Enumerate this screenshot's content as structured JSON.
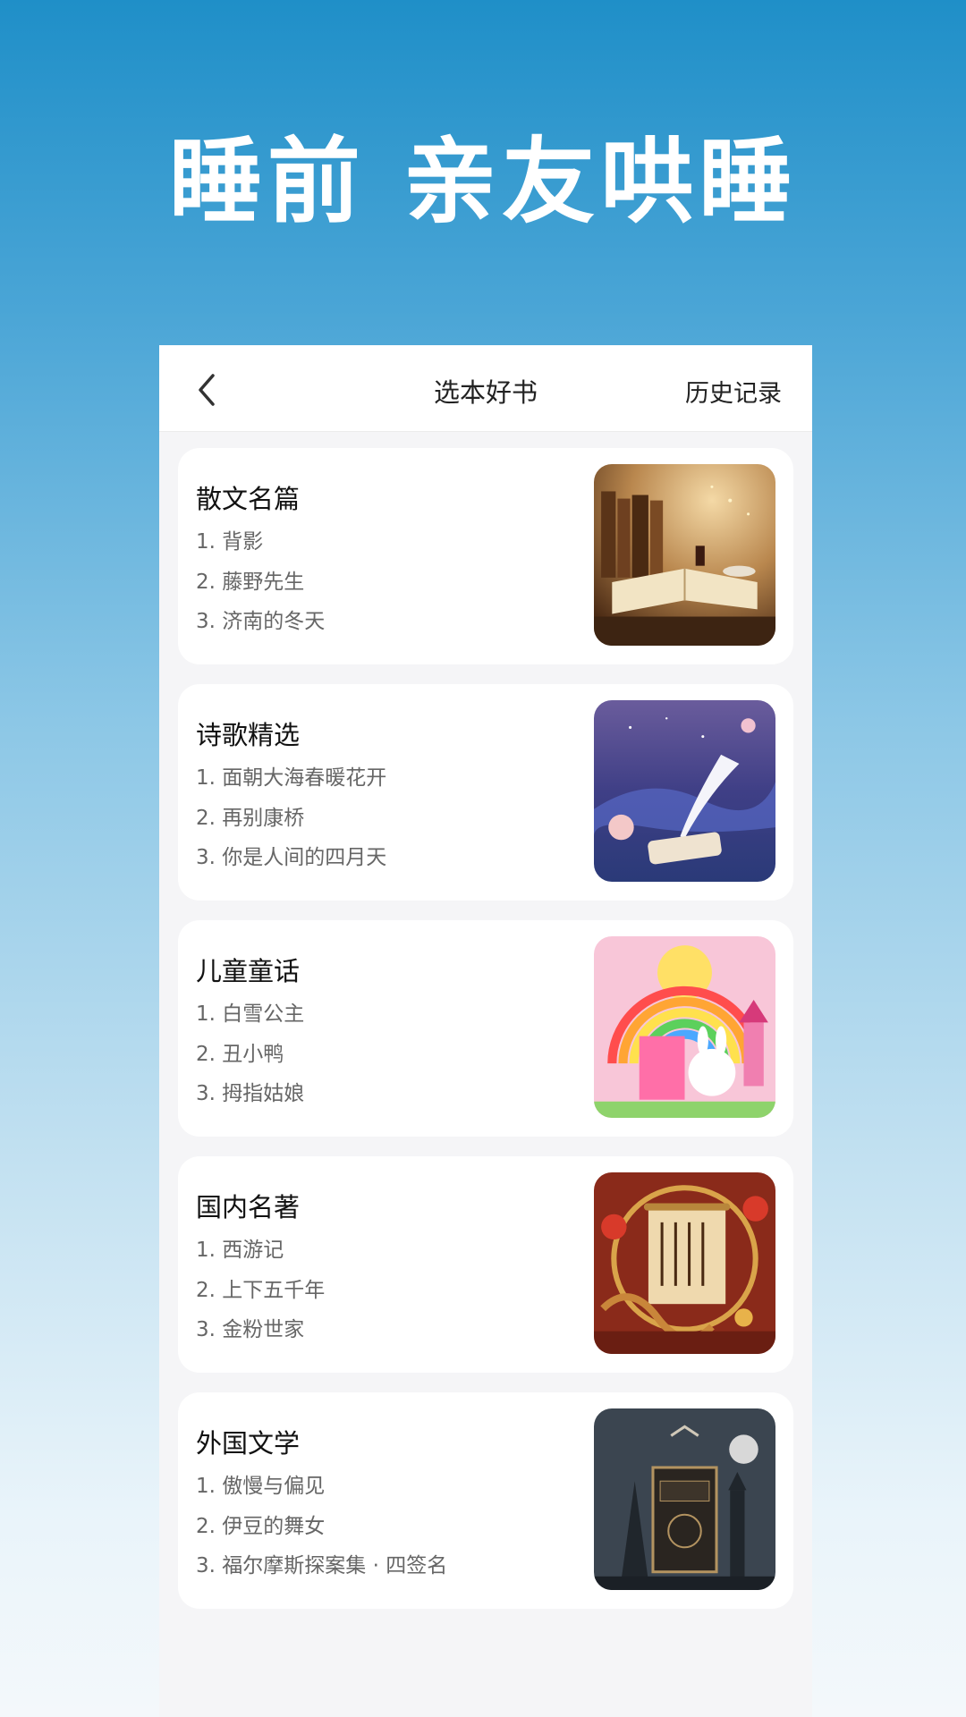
{
  "banner": {
    "title": "睡前  亲友哄睡"
  },
  "topbar": {
    "back_icon": "chevron-left-icon",
    "title": "选本好书",
    "history": "历史记录"
  },
  "categories": [
    {
      "title": "散文名篇",
      "items": [
        "1. 背影",
        "2. 藤野先生",
        "3. 济南的冬天"
      ]
    },
    {
      "title": "诗歌精选",
      "items": [
        "1. 面朝大海春暖花开",
        "2. 再别康桥",
        "3. 你是人间的四月天"
      ]
    },
    {
      "title": "儿童童话",
      "items": [
        "1. 白雪公主",
        "2. 丑小鸭",
        "3. 拇指姑娘"
      ]
    },
    {
      "title": "国内名著",
      "items": [
        "1. 西游记",
        "2. 上下五千年",
        "3. 金粉世家"
      ]
    },
    {
      "title": "外国文学",
      "items": [
        "1. 傲慢与偏见",
        "2. 伊豆的舞女",
        "3. 福尔摩斯探案集 · 四签名"
      ]
    }
  ],
  "colors": {
    "background_top": "#1f8fc8",
    "background_bottom": "#f4f8fb",
    "card": "#ffffff",
    "item_text": "#666666"
  }
}
